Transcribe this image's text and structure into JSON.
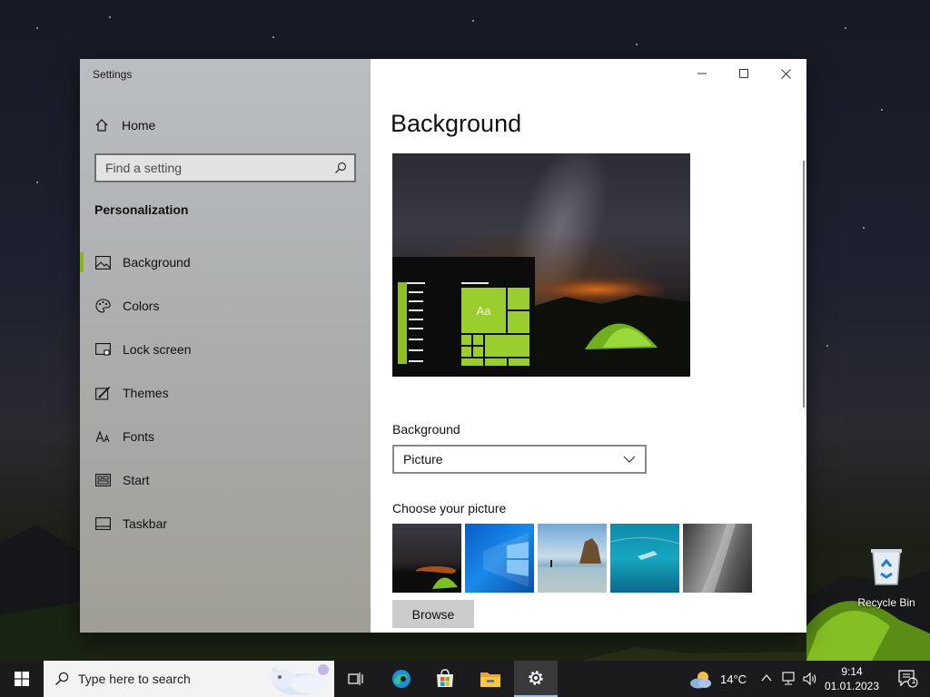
{
  "window": {
    "title": "Settings"
  },
  "sidebar": {
    "home_label": "Home",
    "search_placeholder": "Find a setting",
    "section_title": "Personalization",
    "items": [
      {
        "label": "Background",
        "icon": "picture-icon",
        "active": true
      },
      {
        "label": "Colors",
        "icon": "palette-icon",
        "active": false
      },
      {
        "label": "Lock screen",
        "icon": "lock-screen-icon",
        "active": false
      },
      {
        "label": "Themes",
        "icon": "themes-icon",
        "active": false
      },
      {
        "label": "Fonts",
        "icon": "fonts-icon",
        "active": false
      },
      {
        "label": "Start",
        "icon": "start-icon",
        "active": false
      },
      {
        "label": "Taskbar",
        "icon": "taskbar-icon",
        "active": false
      }
    ]
  },
  "content": {
    "page_title": "Background",
    "preview_tile_text": "Aa",
    "background_label": "Background",
    "background_value": "Picture",
    "choose_picture_label": "Choose your picture",
    "browse_label": "Browse"
  },
  "desktop": {
    "recycle_bin_label": "Recycle Bin"
  },
  "taskbar": {
    "search_placeholder": "Type here to search",
    "weather": "14°C",
    "time": "9:14",
    "date": "01.01.2023",
    "notification_count": "1"
  },
  "colors": {
    "accent": "#86b817",
    "tile": "#9acd2e",
    "taskbar": "#1b1b1d"
  }
}
